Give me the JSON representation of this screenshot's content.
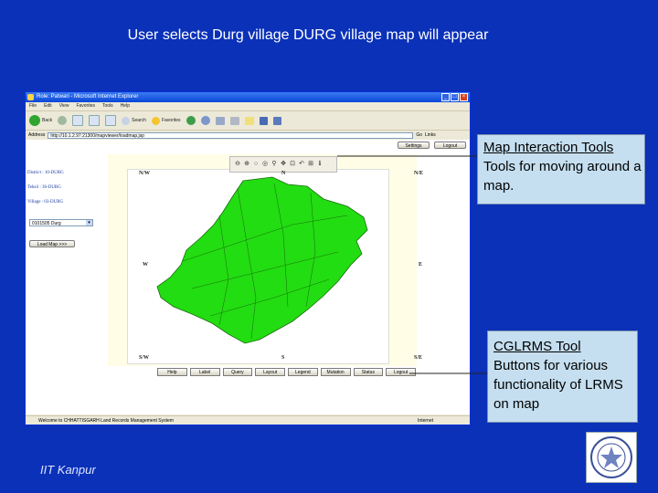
{
  "slide": {
    "title": "User selects Durg village DURG village map will appear",
    "footer": "IIT Kanpur"
  },
  "browser": {
    "title": "Role: Patwari - Microsoft Internet Explorer",
    "menu": [
      "File",
      "Edit",
      "View",
      "Favorites",
      "Tools",
      "Help"
    ],
    "toolbar": {
      "back": "Back",
      "search": "Search",
      "favorites": "Favorites"
    },
    "address_label": "Address",
    "address": "http://10.1.2.97:21300/mapviewer/loadmap.jsp",
    "go": "Go",
    "links": "Links",
    "status_text": "Welcome to CHHATTISGARH Land Records Management System",
    "status_zone": "Internet"
  },
  "app": {
    "settings": "Settings",
    "logout": "Logout",
    "district": "District : 10-DURG",
    "tehsil": "Tehsil : 36-DURG",
    "village": "Village : 03-DURG",
    "village_select": "0101505 Durg",
    "load_map": "Load Map >>>",
    "compass": {
      "nw": "N/W",
      "n": "N",
      "ne": "N/E",
      "w": "W",
      "e": "E",
      "sw": "S/W",
      "s": "S",
      "se": "S/E"
    },
    "map_tools": [
      "⊖",
      "⊕",
      "○",
      "◎",
      "⚲",
      "✥",
      "⊡",
      "↶",
      "⊞",
      "ℹ"
    ],
    "bottom_buttons": [
      "Help",
      "Label",
      "Query",
      "Layout",
      "Legend",
      "Mutation",
      "Status",
      "Logout"
    ]
  },
  "callouts": {
    "map_tools": {
      "head": "Map Interaction Tools",
      "body": "Tools for moving around a map."
    },
    "cglrms": {
      "head": "CGLRMS Tool",
      "body": "Buttons for various functionality of LRMS on map"
    }
  },
  "colors": {
    "slide_bg": "#0a31b8",
    "map_fill": "#22dd11",
    "callout_bg": "#c5dff0"
  }
}
